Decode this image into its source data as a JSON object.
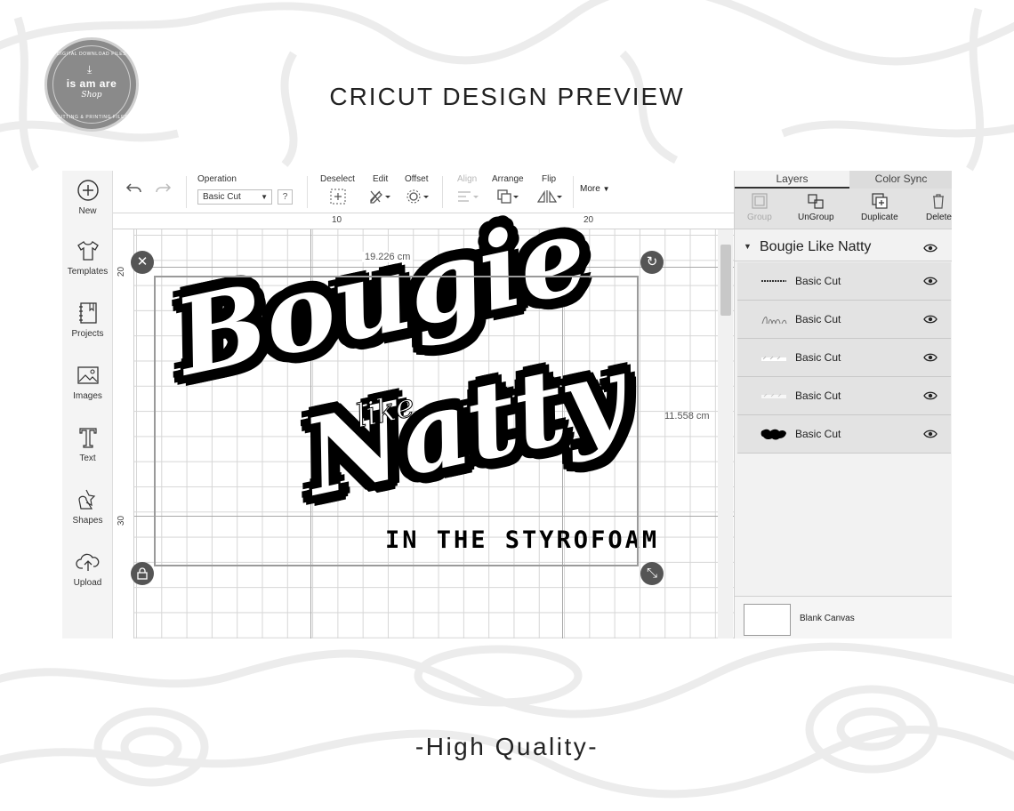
{
  "page": {
    "title": "CRICUT DESIGN PREVIEW",
    "footer": "-High Quality-"
  },
  "logo": {
    "brand": "is am are",
    "script": "Shop",
    "arc_top": "DIGITAL DOWNLOAD FILES",
    "arc_bottom": "CUTTING & PRINTING FILES"
  },
  "sidebar": {
    "items": [
      {
        "label": "New",
        "icon": "plus-circle-icon"
      },
      {
        "label": "Templates",
        "icon": "tshirt-icon"
      },
      {
        "label": "Projects",
        "icon": "notebook-icon"
      },
      {
        "label": "Images",
        "icon": "image-icon"
      },
      {
        "label": "Text",
        "icon": "text-icon"
      },
      {
        "label": "Shapes",
        "icon": "shapes-icon"
      },
      {
        "label": "Upload",
        "icon": "cloud-upload-icon"
      }
    ]
  },
  "toolbar": {
    "operation_label": "Operation",
    "operation_value": "Basic Cut",
    "help_label": "?",
    "deselect_label": "Deselect",
    "edit_label": "Edit",
    "offset_label": "Offset",
    "align_label": "Align",
    "arrange_label": "Arrange",
    "flip_label": "Flip",
    "more_label": "More"
  },
  "canvas": {
    "ruler_top": [
      "10",
      "20"
    ],
    "ruler_left": [
      "20",
      "30"
    ],
    "width_readout": "19.226 cm",
    "height_readout": "11.558 cm",
    "design": {
      "word1": "Bougie",
      "word2": "like",
      "word3": "Natty",
      "word4": "IN THE STYROFOAM"
    }
  },
  "panel": {
    "tabs": [
      "Layers",
      "Color Sync"
    ],
    "actions": [
      {
        "label": "Group",
        "icon": "group-icon",
        "enabled": false
      },
      {
        "label": "UnGroup",
        "icon": "ungroup-icon",
        "enabled": true
      },
      {
        "label": "Duplicate",
        "icon": "duplicate-icon",
        "enabled": true
      },
      {
        "label": "Delete",
        "icon": "trash-icon",
        "enabled": true
      }
    ],
    "group_name": "Bougie Like Natty",
    "layers": [
      {
        "name": "Basic Cut",
        "thumb": "styrofoam-text-thumb"
      },
      {
        "name": "Basic Cut",
        "thumb": "like-outline-thumb"
      },
      {
        "name": "Basic Cut",
        "thumb": "white-text-thumb"
      },
      {
        "name": "Basic Cut",
        "thumb": "light-text-thumb"
      },
      {
        "name": "Basic Cut",
        "thumb": "black-shape-thumb"
      }
    ],
    "canvas_name": "Blank Canvas"
  }
}
